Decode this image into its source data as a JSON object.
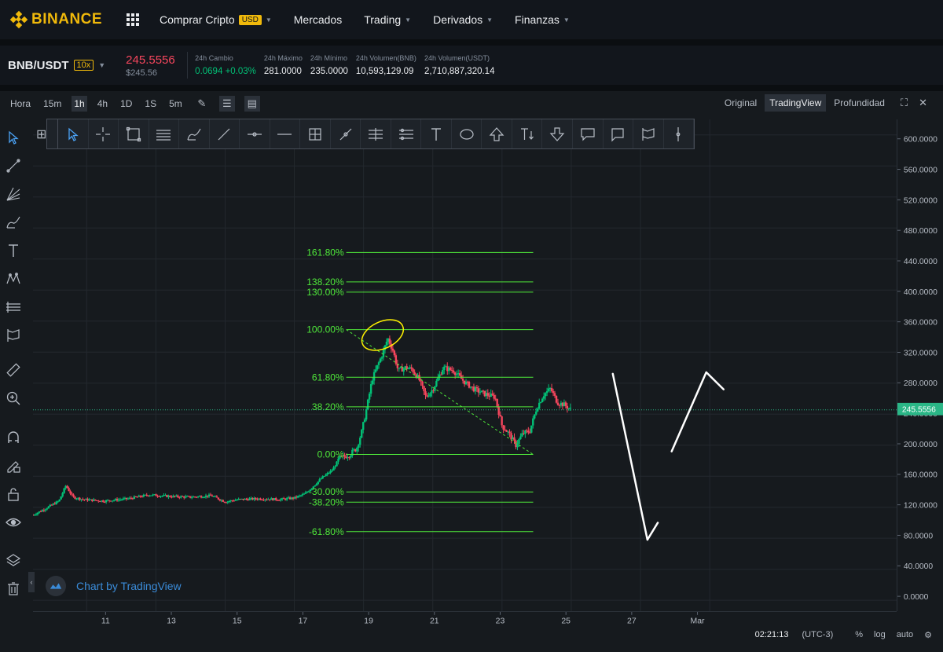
{
  "nav": {
    "brand": "BINANCE",
    "items": [
      {
        "label": "Comprar Cripto",
        "badge": "USD"
      },
      {
        "label": "Mercados"
      },
      {
        "label": "Trading"
      },
      {
        "label": "Derivados"
      },
      {
        "label": "Finanzas"
      }
    ]
  },
  "ticker": {
    "pair": "BNB/USDT",
    "leverage": "10x",
    "last_price": "245.5556",
    "last_price_usd": "$245.56",
    "change_label": "24h Cambio",
    "change_value": "0.0694",
    "change_percent": "+0.03%",
    "high_label": "24h Máximo",
    "high_value": "281.0000",
    "low_label": "24h Mínimo",
    "low_value": "235.0000",
    "vol_bnb_label": "24h Volumen(BNB)",
    "vol_bnb_value": "10,593,129.09",
    "vol_usdt_label": "24h Volumen(USDT)",
    "vol_usdt_value": "2,710,887,320.14"
  },
  "chart_toolbar": {
    "timeframes": [
      "Hora",
      "15m",
      "1h",
      "4h",
      "1D",
      "1S",
      "5m"
    ],
    "active_timeframe": "1h",
    "views": [
      "Original",
      "TradingView",
      "Profundidad"
    ],
    "active_view": "TradingView"
  },
  "chart_data": {
    "type": "candlestick",
    "price_axis": [
      "600.0000",
      "560.0000",
      "520.0000",
      "480.0000",
      "440.0000",
      "400.0000",
      "360.0000",
      "320.0000",
      "280.0000",
      "240.0000",
      "200.0000",
      "160.0000",
      "120.0000",
      "80.0000",
      "40.0000",
      "0.0000"
    ],
    "price_axis_values": [
      600,
      560,
      520,
      480,
      440,
      400,
      360,
      320,
      280,
      240,
      200,
      160,
      120,
      80,
      40,
      0
    ],
    "ylim": [
      -14,
      620
    ],
    "time_axis": [
      "11",
      "13",
      "15",
      "17",
      "19",
      "21",
      "23",
      "25",
      "27",
      "Mar"
    ],
    "time_axis_values": [
      11,
      13,
      15,
      17,
      19,
      21,
      23,
      25,
      27,
      29
    ],
    "xlim": [
      9.45,
      34.4
    ],
    "current_price_label": "245.5556",
    "current_price": 245.56,
    "fibonacci": {
      "start": 188,
      "end": 349,
      "x_start": 18.5,
      "x_end": 23.9,
      "levels": [
        {
          "label": "161.80%",
          "ratio": 1.618
        },
        {
          "label": "138.20%",
          "ratio": 1.382
        },
        {
          "label": "130.00%",
          "ratio": 1.3
        },
        {
          "label": "100.00%",
          "ratio": 1.0
        },
        {
          "label": "61.80%",
          "ratio": 0.618
        },
        {
          "label": "38.20%",
          "ratio": 0.382
        },
        {
          "label": "0.00%",
          "ratio": 0
        },
        {
          "label": "-30.00%",
          "ratio": -0.3
        },
        {
          "label": "-38.20%",
          "ratio": -0.382
        },
        {
          "label": "-61.80%",
          "ratio": -0.618
        }
      ]
    },
    "price_path": [
      [
        9.45,
        110
      ],
      [
        9.8,
        118
      ],
      [
        10.2,
        128
      ],
      [
        10.4,
        148
      ],
      [
        10.6,
        133
      ],
      [
        10.9,
        130
      ],
      [
        11.5,
        128
      ],
      [
        12.2,
        131
      ],
      [
        12.8,
        136
      ],
      [
        13.4,
        134
      ],
      [
        14.0,
        133
      ],
      [
        14.6,
        135
      ],
      [
        15.0,
        127
      ],
      [
        15.4,
        130
      ],
      [
        16.0,
        131
      ],
      [
        16.6,
        130
      ],
      [
        17.0,
        132
      ],
      [
        17.3,
        137
      ],
      [
        17.5,
        145
      ],
      [
        17.8,
        158
      ],
      [
        18.1,
        168
      ],
      [
        18.3,
        183
      ],
      [
        18.6,
        188
      ],
      [
        18.8,
        196
      ],
      [
        18.95,
        218
      ],
      [
        19.1,
        250
      ],
      [
        19.25,
        285
      ],
      [
        19.4,
        302
      ],
      [
        19.55,
        318
      ],
      [
        19.7,
        338
      ],
      [
        19.85,
        322
      ],
      [
        20.0,
        296
      ],
      [
        20.2,
        300
      ],
      [
        20.4,
        298
      ],
      [
        20.6,
        285
      ],
      [
        20.8,
        262
      ],
      [
        21.0,
        272
      ],
      [
        21.3,
        300
      ],
      [
        21.6,
        296
      ],
      [
        21.9,
        282
      ],
      [
        22.2,
        272
      ],
      [
        22.5,
        266
      ],
      [
        22.8,
        262
      ],
      [
        23.0,
        225
      ],
      [
        23.2,
        215
      ],
      [
        23.4,
        200
      ],
      [
        23.6,
        215
      ],
      [
        23.8,
        218
      ],
      [
        24.0,
        248
      ],
      [
        24.2,
        265
      ],
      [
        24.4,
        273
      ],
      [
        24.6,
        255
      ],
      [
        24.8,
        252
      ],
      [
        25.0,
        245.56
      ]
    ],
    "annotations": [
      {
        "type": "ellipse",
        "color": "#fff200",
        "x": 19.55,
        "y": 342
      },
      {
        "type": "freehand",
        "color": "#ffffff",
        "points": [
          [
            26.2,
            292
          ],
          [
            27.2,
            78
          ],
          [
            27.5,
            100
          ]
        ]
      },
      {
        "type": "freehand",
        "color": "#ffffff",
        "points": [
          [
            27.9,
            192
          ],
          [
            28.9,
            294
          ],
          [
            29.4,
            272
          ]
        ]
      }
    ]
  },
  "attribution": "Chart by TradingView",
  "status": {
    "time": "02:21:13",
    "timezone": "(UTC-3)",
    "percent": "%",
    "log": "log",
    "auto": "auto"
  },
  "colors": {
    "accent": "#f0b90b",
    "up": "#02c076",
    "down": "#f6465d",
    "fib": "#4fe83a",
    "price_line": "#2ab686",
    "background": "#161a1e"
  }
}
